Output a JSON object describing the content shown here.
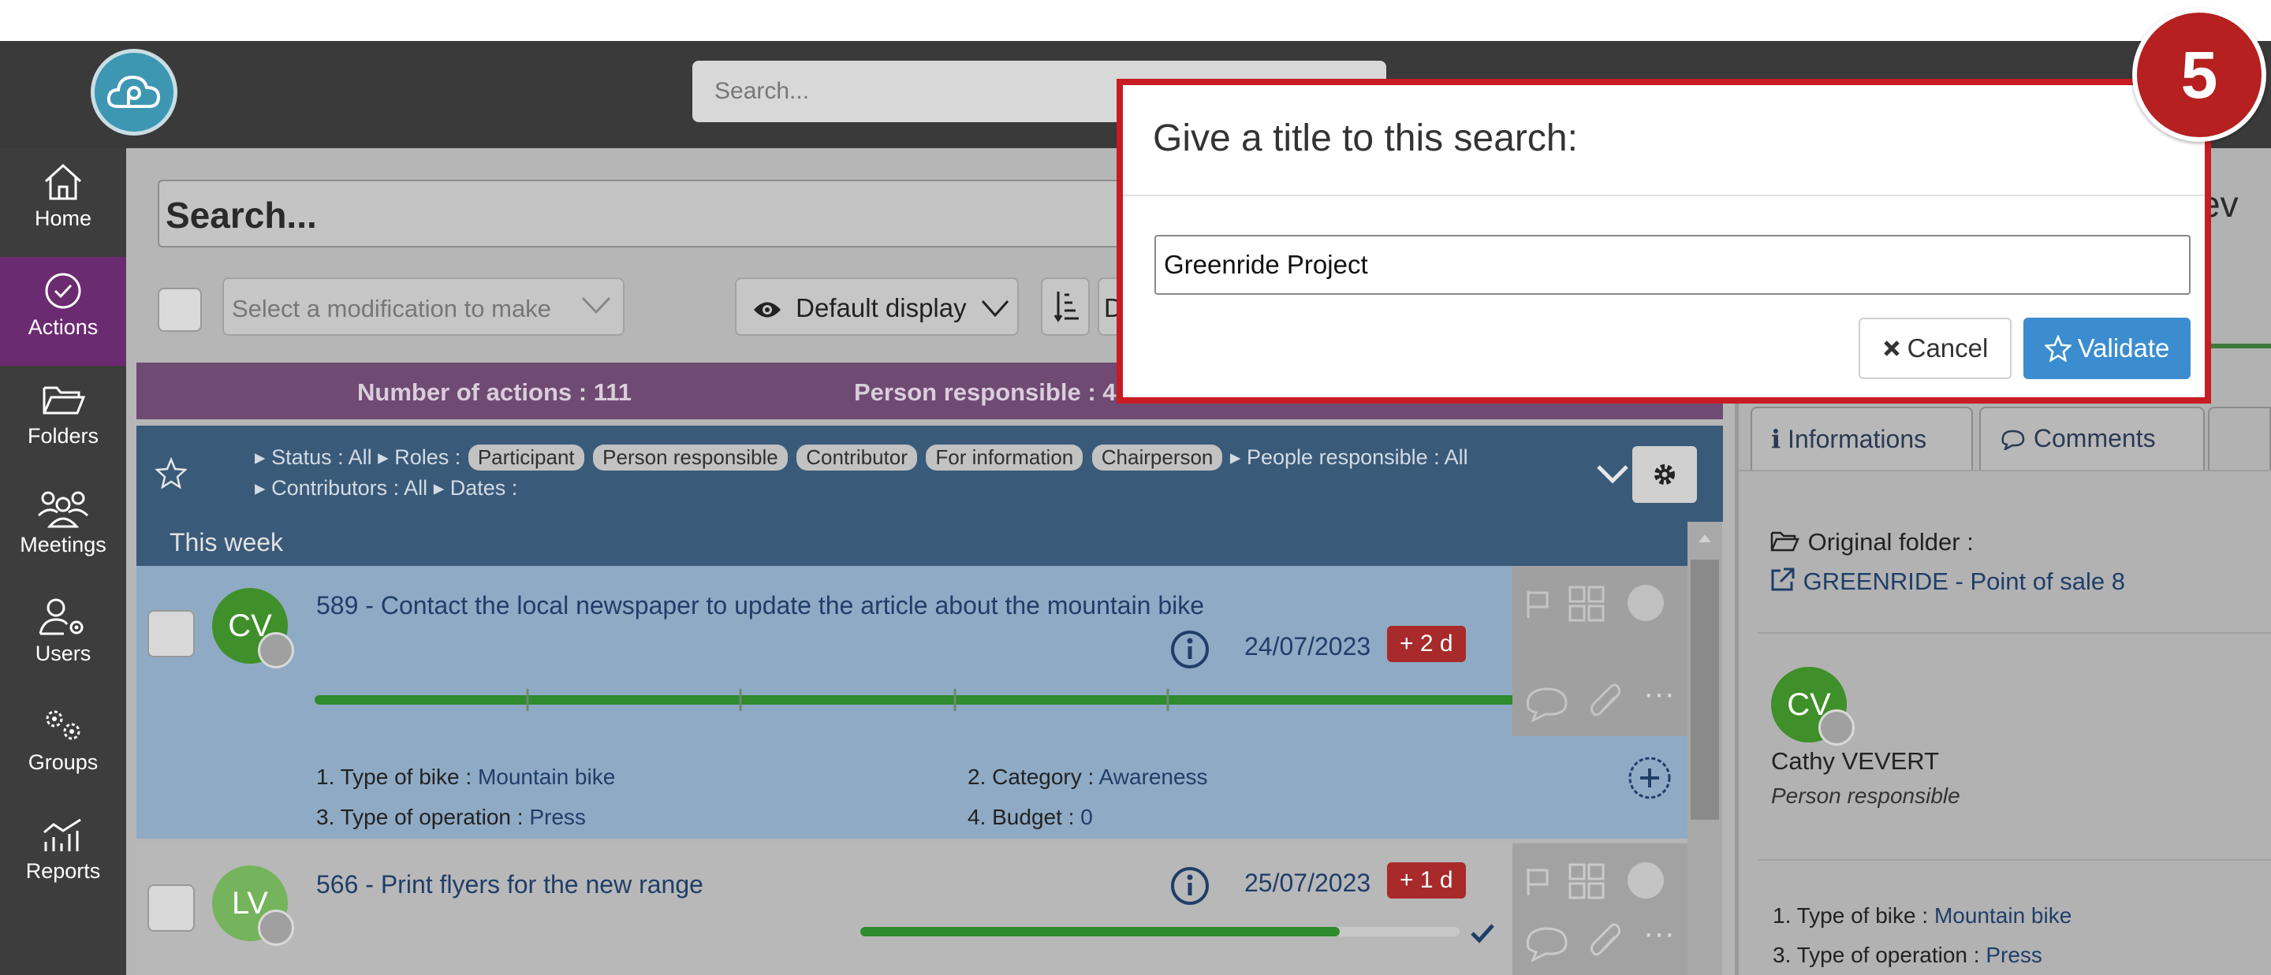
{
  "header": {
    "search_placeholder": "Search..."
  },
  "sidebar": {
    "items": [
      {
        "label": "Home",
        "icon": "home-icon"
      },
      {
        "label": "Actions",
        "icon": "check-circle-icon",
        "active": true
      },
      {
        "label": "Folders",
        "icon": "folder-icon"
      },
      {
        "label": "Meetings",
        "icon": "meetings-icon"
      },
      {
        "label": "Users",
        "icon": "users-icon"
      },
      {
        "label": "Groups",
        "icon": "groups-icon"
      },
      {
        "label": "Reports",
        "icon": "reports-icon"
      }
    ]
  },
  "main": {
    "search_placeholder": "Search...",
    "modification_placeholder": "Select a modification to make",
    "display_label": "Default display",
    "du_label": "Du",
    "stats": {
      "actions": "Number of actions : 111",
      "responsible": "Person responsible : 4"
    },
    "filters": {
      "status": "Status : All",
      "roles_label": "Roles :",
      "roles": [
        "Participant",
        "Person responsible",
        "Contributor",
        "For information",
        "Chairperson"
      ],
      "people_responsible": "People responsible : All",
      "contributors": "Contributors : All",
      "dates": "Dates :"
    },
    "week_header": "This week",
    "actions": [
      {
        "title": "589 - Contact the local newspaper to update the article about the mountain bike",
        "initials": "CV",
        "avatar_color": "#3f8f2a",
        "date": "24/07/2023",
        "delay": "+ 2 d",
        "progress": 1.0,
        "fields": [
          {
            "label": "1. Type of bike :",
            "value": "Mountain bike"
          },
          {
            "label": "2. Category :",
            "value": "Awareness"
          },
          {
            "label": "3. Type of operation :",
            "value": "Press"
          },
          {
            "label": "4. Budget :",
            "value": "0"
          }
        ]
      },
      {
        "title": "566 - Print flyers for the new range",
        "initials": "LV",
        "avatar_color": "#75b45c",
        "date": "25/07/2023",
        "delay": "+ 1 d",
        "progress": 0.8
      }
    ]
  },
  "right_panel": {
    "tabs": [
      "Informations",
      "Comments"
    ],
    "original_folder_label": "Original folder :",
    "original_folder_link": "GREENRIDE - Point of sale 8",
    "person_initials": "CV",
    "person_name": "Cathy VEVERT",
    "person_role": "Person responsible",
    "fields": [
      {
        "label": "1. Type of bike :",
        "value": "Mountain bike"
      },
      {
        "label": "3. Type of operation :",
        "value": "Press"
      }
    ],
    "edge_text": "ev"
  },
  "modal": {
    "title": "Give a title to this search:",
    "input_value": "Greenride Project",
    "cancel_label": "Cancel",
    "validate_label": "Validate"
  },
  "step_number": "5",
  "colors": {
    "modal_border": "#c71c22",
    "validate": "#3c8dd0",
    "delay_badge": "#a82a2a",
    "progress": "#2e8b2e",
    "active_nav": "#6b2b70"
  }
}
